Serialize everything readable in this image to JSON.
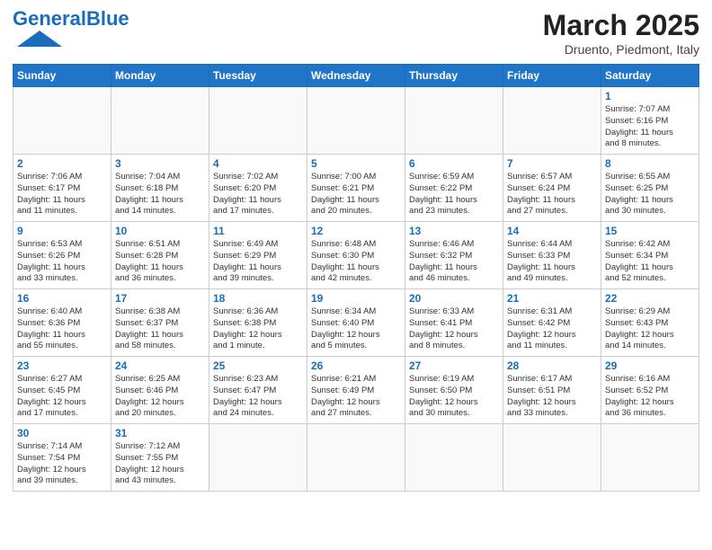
{
  "logo": {
    "text_general": "General",
    "text_blue": "Blue"
  },
  "title": "March 2025",
  "subtitle": "Druento, Piedmont, Italy",
  "header_days": [
    "Sunday",
    "Monday",
    "Tuesday",
    "Wednesday",
    "Thursday",
    "Friday",
    "Saturday"
  ],
  "weeks": [
    [
      {
        "day": "",
        "info": ""
      },
      {
        "day": "",
        "info": ""
      },
      {
        "day": "",
        "info": ""
      },
      {
        "day": "",
        "info": ""
      },
      {
        "day": "",
        "info": ""
      },
      {
        "day": "",
        "info": ""
      },
      {
        "day": "1",
        "info": "Sunrise: 7:07 AM\nSunset: 6:16 PM\nDaylight: 11 hours\nand 8 minutes."
      }
    ],
    [
      {
        "day": "2",
        "info": "Sunrise: 7:06 AM\nSunset: 6:17 PM\nDaylight: 11 hours\nand 11 minutes."
      },
      {
        "day": "3",
        "info": "Sunrise: 7:04 AM\nSunset: 6:18 PM\nDaylight: 11 hours\nand 14 minutes."
      },
      {
        "day": "4",
        "info": "Sunrise: 7:02 AM\nSunset: 6:20 PM\nDaylight: 11 hours\nand 17 minutes."
      },
      {
        "day": "5",
        "info": "Sunrise: 7:00 AM\nSunset: 6:21 PM\nDaylight: 11 hours\nand 20 minutes."
      },
      {
        "day": "6",
        "info": "Sunrise: 6:59 AM\nSunset: 6:22 PM\nDaylight: 11 hours\nand 23 minutes."
      },
      {
        "day": "7",
        "info": "Sunrise: 6:57 AM\nSunset: 6:24 PM\nDaylight: 11 hours\nand 27 minutes."
      },
      {
        "day": "8",
        "info": "Sunrise: 6:55 AM\nSunset: 6:25 PM\nDaylight: 11 hours\nand 30 minutes."
      }
    ],
    [
      {
        "day": "9",
        "info": "Sunrise: 6:53 AM\nSunset: 6:26 PM\nDaylight: 11 hours\nand 33 minutes."
      },
      {
        "day": "10",
        "info": "Sunrise: 6:51 AM\nSunset: 6:28 PM\nDaylight: 11 hours\nand 36 minutes."
      },
      {
        "day": "11",
        "info": "Sunrise: 6:49 AM\nSunset: 6:29 PM\nDaylight: 11 hours\nand 39 minutes."
      },
      {
        "day": "12",
        "info": "Sunrise: 6:48 AM\nSunset: 6:30 PM\nDaylight: 11 hours\nand 42 minutes."
      },
      {
        "day": "13",
        "info": "Sunrise: 6:46 AM\nSunset: 6:32 PM\nDaylight: 11 hours\nand 46 minutes."
      },
      {
        "day": "14",
        "info": "Sunrise: 6:44 AM\nSunset: 6:33 PM\nDaylight: 11 hours\nand 49 minutes."
      },
      {
        "day": "15",
        "info": "Sunrise: 6:42 AM\nSunset: 6:34 PM\nDaylight: 11 hours\nand 52 minutes."
      }
    ],
    [
      {
        "day": "16",
        "info": "Sunrise: 6:40 AM\nSunset: 6:36 PM\nDaylight: 11 hours\nand 55 minutes."
      },
      {
        "day": "17",
        "info": "Sunrise: 6:38 AM\nSunset: 6:37 PM\nDaylight: 11 hours\nand 58 minutes."
      },
      {
        "day": "18",
        "info": "Sunrise: 6:36 AM\nSunset: 6:38 PM\nDaylight: 12 hours\nand 1 minute."
      },
      {
        "day": "19",
        "info": "Sunrise: 6:34 AM\nSunset: 6:40 PM\nDaylight: 12 hours\nand 5 minutes."
      },
      {
        "day": "20",
        "info": "Sunrise: 6:33 AM\nSunset: 6:41 PM\nDaylight: 12 hours\nand 8 minutes."
      },
      {
        "day": "21",
        "info": "Sunrise: 6:31 AM\nSunset: 6:42 PM\nDaylight: 12 hours\nand 11 minutes."
      },
      {
        "day": "22",
        "info": "Sunrise: 6:29 AM\nSunset: 6:43 PM\nDaylight: 12 hours\nand 14 minutes."
      }
    ],
    [
      {
        "day": "23",
        "info": "Sunrise: 6:27 AM\nSunset: 6:45 PM\nDaylight: 12 hours\nand 17 minutes."
      },
      {
        "day": "24",
        "info": "Sunrise: 6:25 AM\nSunset: 6:46 PM\nDaylight: 12 hours\nand 20 minutes."
      },
      {
        "day": "25",
        "info": "Sunrise: 6:23 AM\nSunset: 6:47 PM\nDaylight: 12 hours\nand 24 minutes."
      },
      {
        "day": "26",
        "info": "Sunrise: 6:21 AM\nSunset: 6:49 PM\nDaylight: 12 hours\nand 27 minutes."
      },
      {
        "day": "27",
        "info": "Sunrise: 6:19 AM\nSunset: 6:50 PM\nDaylight: 12 hours\nand 30 minutes."
      },
      {
        "day": "28",
        "info": "Sunrise: 6:17 AM\nSunset: 6:51 PM\nDaylight: 12 hours\nand 33 minutes."
      },
      {
        "day": "29",
        "info": "Sunrise: 6:16 AM\nSunset: 6:52 PM\nDaylight: 12 hours\nand 36 minutes."
      }
    ],
    [
      {
        "day": "30",
        "info": "Sunrise: 7:14 AM\nSunset: 7:54 PM\nDaylight: 12 hours\nand 39 minutes."
      },
      {
        "day": "31",
        "info": "Sunrise: 7:12 AM\nSunset: 7:55 PM\nDaylight: 12 hours\nand 43 minutes."
      },
      {
        "day": "",
        "info": ""
      },
      {
        "day": "",
        "info": ""
      },
      {
        "day": "",
        "info": ""
      },
      {
        "day": "",
        "info": ""
      },
      {
        "day": "",
        "info": ""
      }
    ]
  ]
}
